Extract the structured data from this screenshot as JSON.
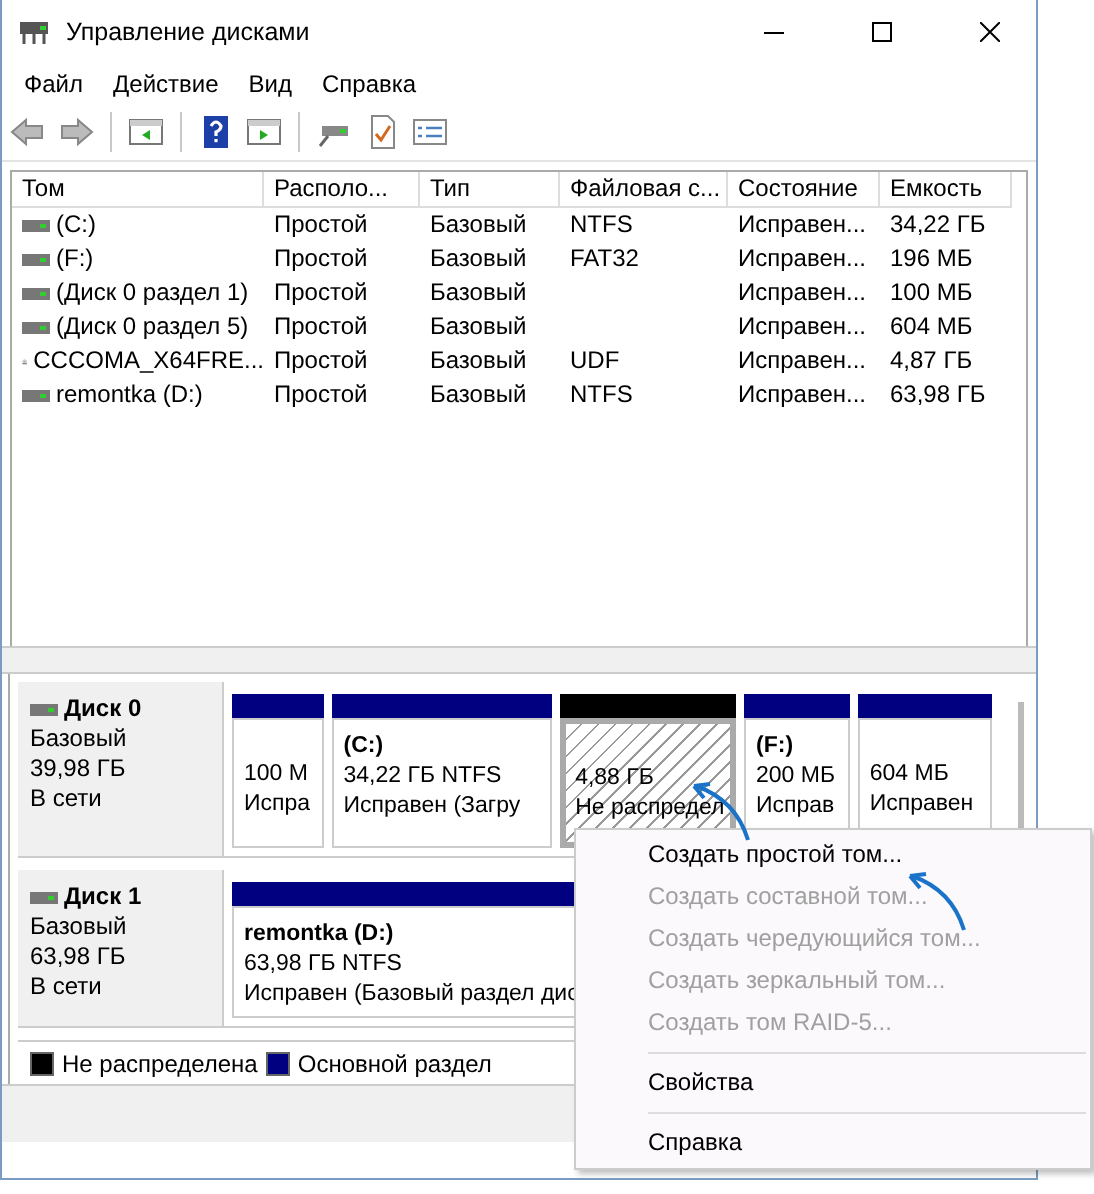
{
  "window": {
    "title": "Управление дисками"
  },
  "menu": [
    "Файл",
    "Действие",
    "Вид",
    "Справка"
  ],
  "toolbar": [
    {
      "kind": "back"
    },
    {
      "kind": "forward"
    },
    {
      "kind": "separator"
    },
    {
      "kind": "panel"
    },
    {
      "kind": "separator"
    },
    {
      "kind": "help"
    },
    {
      "kind": "play"
    },
    {
      "kind": "separator"
    },
    {
      "kind": "connect"
    },
    {
      "kind": "check"
    },
    {
      "kind": "list"
    }
  ],
  "table": {
    "columns": [
      "Том",
      "Располо...",
      "Тип",
      "Файловая с...",
      "Состояние",
      "Емкость"
    ],
    "rows": [
      {
        "kind": "disk",
        "cells": [
          " (C:)",
          "Простой",
          "Базовый",
          "NTFS",
          "Исправен...",
          "34,22 ГБ"
        ]
      },
      {
        "kind": "disk",
        "cells": [
          " (F:)",
          "Простой",
          "Базовый",
          "FAT32",
          "Исправен...",
          "196 МБ"
        ]
      },
      {
        "kind": "disk",
        "cells": [
          "(Диск 0 раздел 1)",
          "Простой",
          "Базовый",
          "",
          "Исправен...",
          "100 МБ"
        ]
      },
      {
        "kind": "disk",
        "cells": [
          "(Диск 0 раздел 5)",
          "Простой",
          "Базовый",
          "",
          "Исправен...",
          "604 МБ"
        ]
      },
      {
        "kind": "cd",
        "cells": [
          "CCCOMA_X64FRE...",
          "Простой",
          "Базовый",
          "UDF",
          "Исправен...",
          "4,87 ГБ"
        ]
      },
      {
        "kind": "disk",
        "cells": [
          "remontka (D:)",
          "Простой",
          "Базовый",
          "NTFS",
          "Исправен...",
          "63,98 ГБ"
        ]
      }
    ]
  },
  "disks": [
    {
      "name": "Диск 0",
      "type": "Базовый",
      "size": "39,98 ГБ",
      "status": "В сети",
      "partitions": [
        {
          "kind": "primary",
          "lines": [
            "100 М",
            "Испра"
          ]
        },
        {
          "kind": "primary",
          "title": "(C:)",
          "lines": [
            "34,22 ГБ NTFS",
            "Исправен (Загру"
          ]
        },
        {
          "kind": "unallocated",
          "lines": [
            "4,88 ГБ",
            "Не распредел"
          ]
        },
        {
          "kind": "primary",
          "title": "(F:)",
          "lines": [
            "200 МБ",
            "Исправ"
          ]
        },
        {
          "kind": "primary",
          "lines": [
            "604 МБ",
            "Исправен"
          ]
        }
      ]
    },
    {
      "name": "Диск 1",
      "type": "Базовый",
      "size": "63,98 ГБ",
      "status": "В сети",
      "partitions": [
        {
          "kind": "primary",
          "title": "remontka  (D:)",
          "lines": [
            "63,98 ГБ NTFS",
            "Исправен (Базовый раздел дис"
          ]
        }
      ]
    }
  ],
  "legend": [
    {
      "label": "Не распределена",
      "color": "#000000"
    },
    {
      "label": "Основной раздел",
      "color": "#000080"
    }
  ],
  "context_menu": [
    [
      {
        "label": "Создать простой том...",
        "disabled": false
      },
      {
        "label": "Создать составной том...",
        "disabled": true
      },
      {
        "label": "Создать чередующийся том...",
        "disabled": true
      },
      {
        "label": "Создать зеркальный том...",
        "disabled": true
      },
      {
        "label": "Создать том RAID-5...",
        "disabled": true
      }
    ],
    [
      {
        "label": "Свойства",
        "disabled": false
      }
    ],
    [
      {
        "label": "Справка",
        "disabled": false
      }
    ]
  ]
}
